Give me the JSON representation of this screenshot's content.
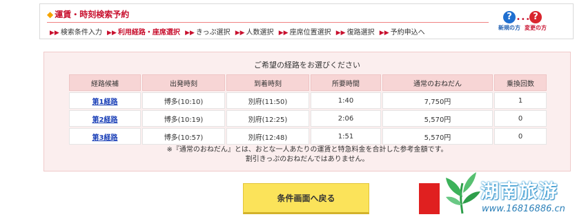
{
  "header": {
    "title": "運賃・時刻検索予約",
    "steps": [
      {
        "label": "検索条件入力",
        "current": false
      },
      {
        "label": "利用経路・座席選択",
        "current": true
      },
      {
        "label": "きっぷ選択",
        "current": false
      },
      {
        "label": "人数選択",
        "current": false
      },
      {
        "label": "座席位置選択",
        "current": false
      },
      {
        "label": "復路選択",
        "current": false
      },
      {
        "label": "予約申込へ",
        "current": false
      }
    ],
    "help_new": "新規の方",
    "help_change": "変更の方"
  },
  "routes": {
    "instruction": "ご希望の経路をお選びください",
    "columns": [
      "経路候補",
      "出発時刻",
      "到着時刻",
      "所要時間",
      "通常のおねだん",
      "乗換回数"
    ],
    "rows": [
      {
        "route": "第1経路",
        "depart": "博多(10:10)",
        "arrive": "別府(11:50)",
        "duration": "1:40",
        "price": "7,750円",
        "transfers": "1"
      },
      {
        "route": "第2経路",
        "depart": "博多(10:19)",
        "arrive": "別府(12:25)",
        "duration": "2:06",
        "price": "5,570円",
        "transfers": "0"
      },
      {
        "route": "第3経路",
        "depart": "博多(10:57)",
        "arrive": "別府(12:48)",
        "duration": "1:51",
        "price": "5,570円",
        "transfers": "0"
      }
    ],
    "note_line1": "※『通常のおねだん』とは、おとな一人あたりの運賃と特急料金を合計した参考金額です。",
    "note_line2": "割引きっぷのおねだんではありません。"
  },
  "buttons": {
    "back": "条件画面へ戻る"
  },
  "watermark": {
    "text": "湖南旅游",
    "url": "www.16816886.cn"
  },
  "colors": {
    "accent_red": "#c8102e",
    "panel_bg": "#fbeeee",
    "header_cell": "#f7d5d5",
    "button_yellow": "#fbe35a",
    "link_blue": "#1a3fb7"
  }
}
